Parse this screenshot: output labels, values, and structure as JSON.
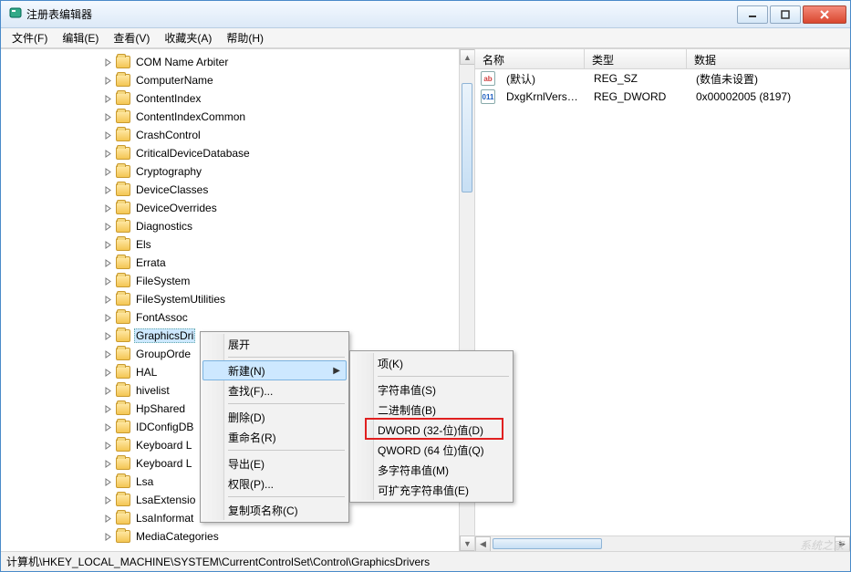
{
  "window": {
    "title": "注册表编辑器"
  },
  "titlebar_buttons": {
    "min": "minimize",
    "max": "maximize",
    "close": "close"
  },
  "menu": {
    "file": "文件(F)",
    "edit": "编辑(E)",
    "view": "查看(V)",
    "favorites": "收藏夹(A)",
    "help": "帮助(H)"
  },
  "tree_items": [
    "COM Name Arbiter",
    "ComputerName",
    "ContentIndex",
    "ContentIndexCommon",
    "CrashControl",
    "CriticalDeviceDatabase",
    "Cryptography",
    "DeviceClasses",
    "DeviceOverrides",
    "Diagnostics",
    "Els",
    "Errata",
    "FileSystem",
    "FileSystemUtilities",
    "FontAssoc",
    "GraphicsDri",
    "GroupOrde",
    "HAL",
    "hivelist",
    "HpShared",
    "IDConfigDB",
    "Keyboard L",
    "Keyboard L",
    "Lsa",
    "LsaExtensio",
    "LsaInformat",
    "MediaCategories"
  ],
  "tree_selected_index": 15,
  "list_header": {
    "name": "名称",
    "type": "类型",
    "data": "数据"
  },
  "list_rows": [
    {
      "icon": "ab",
      "icon_kind": "sz",
      "name": "(默认)",
      "type": "REG_SZ",
      "data": "(数值未设置)"
    },
    {
      "icon": "011",
      "icon_kind": "dw",
      "name": "DxgKrnlVersion",
      "type": "REG_DWORD",
      "data": "0x00002005 (8197)"
    }
  ],
  "context1": {
    "expand": "展开",
    "new": "新建(N)",
    "find": "查找(F)...",
    "delete": "删除(D)",
    "rename": "重命名(R)",
    "export": "导出(E)",
    "permissions": "权限(P)...",
    "copy_key_name": "复制项名称(C)"
  },
  "context2": {
    "key": "项(K)",
    "string": "字符串值(S)",
    "binary": "二进制值(B)",
    "dword": "DWORD (32-位)值(D)",
    "qword": "QWORD (64 位)值(Q)",
    "multi_string": "多字符串值(M)",
    "expand_string": "可扩充字符串值(E)"
  },
  "statusbar": {
    "path": "计算机\\HKEY_LOCAL_MACHINE\\SYSTEM\\CurrentControlSet\\Control\\GraphicsDrivers"
  },
  "watermark": "系统之家"
}
